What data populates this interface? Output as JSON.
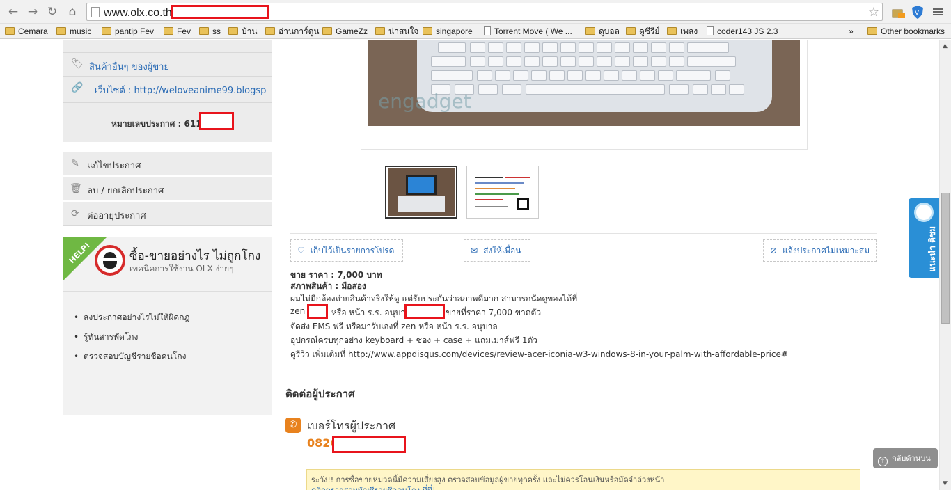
{
  "browser": {
    "url": "www.olx.co.th",
    "bookmarks": [
      {
        "label": "Cemara",
        "type": "folder"
      },
      {
        "label": "music",
        "type": "folder"
      },
      {
        "label": "pantip Fev",
        "type": "folder"
      },
      {
        "label": "Fev",
        "type": "folder"
      },
      {
        "label": "ss",
        "type": "folder"
      },
      {
        "label": "บ้าน",
        "type": "folder"
      },
      {
        "label": "อ่านการ์ตูน",
        "type": "folder"
      },
      {
        "label": "GameZz",
        "type": "folder"
      },
      {
        "label": "น่าสนใจ",
        "type": "folder"
      },
      {
        "label": "singapore",
        "type": "folder"
      },
      {
        "label": "Torrent Move ( We ...",
        "type": "page"
      },
      {
        "label": "ดูบอล",
        "type": "folder"
      },
      {
        "label": "ดูซีรีย์",
        "type": "folder"
      },
      {
        "label": "เพลง",
        "type": "folder"
      },
      {
        "label": "coder143 JS 2.3",
        "type": "page"
      }
    ],
    "overflow": "»",
    "other_bookmarks": "Other bookmarks"
  },
  "sidebar": {
    "other_products": "สินค้าอื่นๆ ของผู้ขาย",
    "website": "เว็บไซต์ : http://weloveanime99.blogsp",
    "ad_number_label": "หมายเลขประกาศ : 611",
    "actions": [
      {
        "label": "แก้ไขประกาศ",
        "icon": "pencil-icon"
      },
      {
        "label": "ลบ / ยกเลิกประกาศ",
        "icon": "trash-icon"
      },
      {
        "label": "ต่ออายุประกาศ",
        "icon": "refresh-icon"
      }
    ],
    "help": {
      "ribbon": "HELP!",
      "title": "ซื้อ-ขายอย่างไร ไม่ถูกโกง",
      "subtitle": "เทคนิคการใช้งาน OLX ง่ายๆ",
      "links": [
        "ลงประกาศอย่างไรไม่ให้ผิดกฎ",
        "รู้ทันสารพัดโกง",
        "ตรวจสอบบัญชีรายชื่อคนโกง"
      ]
    }
  },
  "listing": {
    "watermark": "engadget",
    "actions": {
      "save": "เก็บไว้เป็นรายการโปรด",
      "share": "ส่งให้เพื่อน",
      "report": "แจ้งประกาศไม่เหมาะสม"
    },
    "price_line": "ขาย ราคา : 7,000 บาท",
    "condition_line": "สภาพสินค้า : มือสอง",
    "lines": [
      "ผมไม่มีกล้องถ่ายสินค้าจริงให้ดู แต่รับประกันว่าสภาพดีมาก สามารถนัดดูของได้ที่",
      "zen",
      "หรือ หน้า ร.ร. อนุบา",
      "ขายที่ราคา 7,000 ขาดตัว",
      "จัดส่ง EMS ฟรี หรือมารับเองที่ zen หรือ หน้า ร.ร. อนุบาล",
      "อุปกรณ์ครบทุกอย่าง keyboard + ซอง + case + แถมเมาส์ฟรี 1ตัว",
      "ดูรีวิว เพิ่มเติมที่ http://www.appdisqus.com/devices/review-acer-iconia-w3-windows-8-in-your-palm-with-affordable-price#"
    ],
    "contact_title": "ติดต่อผู้ประกาศ",
    "phone_label": "เบอร์โทรผู้ประกาศ",
    "phone_prefix": "0826",
    "warning_line1": "ระวัง!! การซื้อขายหมวดนี้มีความเสี่ยงสูง ตรวจสอบข้อมูลผู้ขายทุกครั้ง และไม่ควรโอนเงินหรือมัดจำล่วงหน้า",
    "warning_line2": "คลิกตรวจสอบบัญชีรายชื่อคนโกง ที่นี่!"
  },
  "floating": {
    "back_to_top": "กลับด้านบน",
    "feedback": "แนะนำ ติชม"
  },
  "colors": {
    "link": "#2a6bb5",
    "accent_orange": "#e8821e",
    "redaction": "#e8141c",
    "help_green": "#6fb843",
    "feedback_blue": "#2a8fd6"
  }
}
